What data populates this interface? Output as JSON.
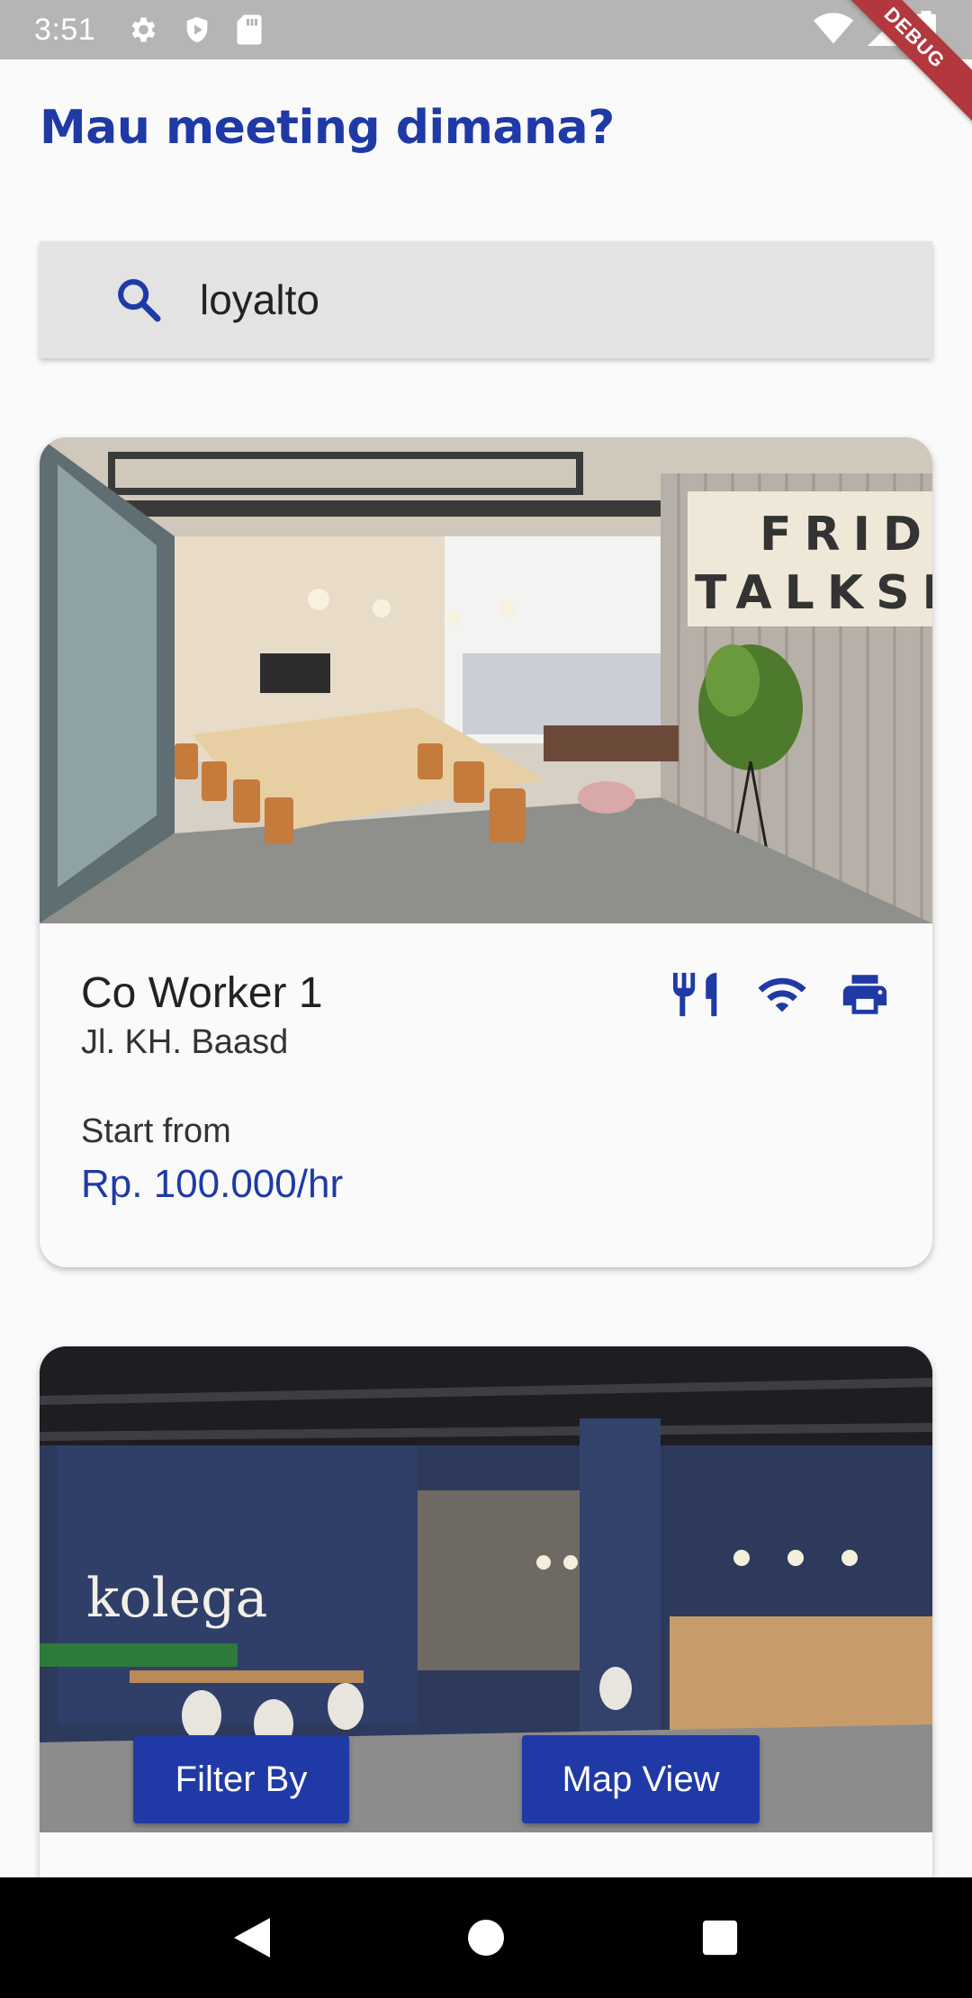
{
  "status_bar": {
    "time": "3:51",
    "left_icons": [
      "gear-icon",
      "shield-play-icon",
      "sd-card-icon"
    ],
    "right_icons": [
      "wifi-icon",
      "signal-icon",
      "battery-icon"
    ],
    "debug_label": "DEBUG"
  },
  "header": {
    "title": "Mau meeting dimana?"
  },
  "search": {
    "value": "loyalto",
    "icon": "search-icon"
  },
  "cards": [
    {
      "name": "Co Worker 1",
      "address": "Jl. KH. Baasd",
      "start_label": "Start from",
      "price": "Rp. 100.000/hr",
      "amenities": [
        "restaurant-icon",
        "wifi-icon",
        "printer-icon"
      ],
      "image_text": "FRID TALKSH"
    },
    {
      "image_text": "kolega"
    }
  ],
  "buttons": {
    "filter": "Filter By",
    "map": "Map View"
  },
  "nav": [
    "back-icon",
    "home-icon",
    "recents-icon"
  ],
  "colors": {
    "accent": "#1f3aa6",
    "status_bar": "#b5b5b5",
    "debug": "#b3383e"
  }
}
